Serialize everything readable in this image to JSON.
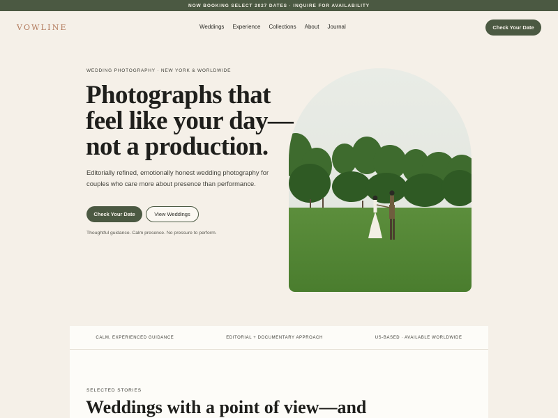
{
  "announcement": "NOW BOOKING SELECT 2027 DATES · INQUIRE FOR AVAILABILITY",
  "brand": "VOWLINE",
  "nav": [
    "Weddings",
    "Experience",
    "Collections",
    "About",
    "Journal"
  ],
  "header_cta": "Check Your Date",
  "hero": {
    "eyebrow": "WEDDING PHOTOGRAPHY · NEW YORK & WORLDWIDE",
    "headline": "Photographs that feel like your day—not a production.",
    "subhead": "Editorially refined, emotionally honest wedding photography for couples who care more about presence than performance.",
    "primary_cta": "Check Your Date",
    "secondary_cta": "View Weddings",
    "reassurance": "Thoughtful guidance. Calm presence. No pressure to perform."
  },
  "values": [
    "CALM, EXPERIENCED GUIDANCE",
    "EDITORIAL + DOCUMENTARY APPROACH",
    "US-BASED · AVAILABLE WORLDWIDE"
  ],
  "stories": {
    "eyebrow": "SELECTED STORIES",
    "title": "Weddings with a point of view—and"
  },
  "colors": {
    "accent": "#4b5942",
    "background": "#f5f0e8",
    "brand": "#b27a5c"
  }
}
